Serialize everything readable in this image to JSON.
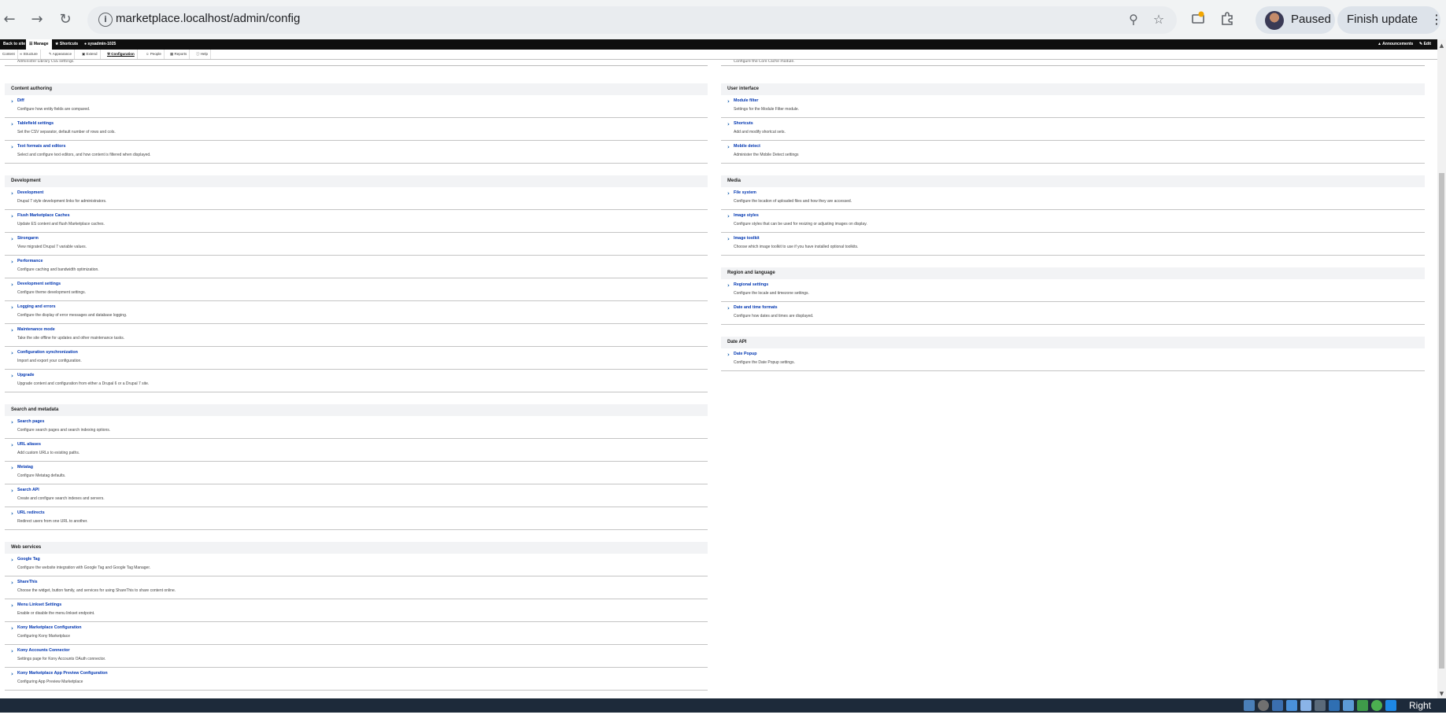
{
  "browser": {
    "url": "marketplace.localhost/admin/config",
    "profile_status": "Paused",
    "update_button": "Finish update",
    "icons": [
      "back-icon",
      "forward-icon",
      "reload-icon",
      "info-icon",
      "zoom-icon",
      "bookmark-star-icon",
      "extension-alert-icon",
      "puzzle-icon",
      "kebab-menu-icon"
    ]
  },
  "admin_toolbar": {
    "back": "Back to site",
    "manage": "Manage",
    "shortcuts": "Shortcuts",
    "user": "sysadmin-1025",
    "announcements": "Announcements",
    "edit": "Edit"
  },
  "tray": {
    "items": [
      "Content",
      "Structure",
      "Appearance",
      "Extend",
      "Configuration",
      "People",
      "Reports",
      "Help"
    ],
    "active": "Configuration"
  },
  "top_partial": {
    "left_desc": "Administer Library CSS settings.",
    "right_desc": "Configure the Core Cache module."
  },
  "left_panels": [
    {
      "heading": "Content authoring",
      "items": [
        {
          "title": "Diff",
          "desc": "Configure how entity fields are compared."
        },
        {
          "title": "Tablefield settings",
          "desc": "Set the CSV separator, default number of rows and cols."
        },
        {
          "title": "Text formats and editors",
          "desc": "Select and configure text editors, and how content is filtered when displayed."
        }
      ]
    },
    {
      "heading": "Development",
      "items": [
        {
          "title": "Development",
          "desc": "Drupal 7 style development links for administrators."
        },
        {
          "title": "Flush Marketplace Caches",
          "desc": "Update ES content and flush Marketplace caches."
        },
        {
          "title": "Strongarm",
          "desc": "View migrated Drupal 7 variable values."
        },
        {
          "title": "Performance",
          "desc": "Configure caching and bandwidth optimization."
        },
        {
          "title": "Development settings",
          "desc": "Configure theme development settings."
        },
        {
          "title": "Logging and errors",
          "desc": "Configure the display of error messages and database logging."
        },
        {
          "title": "Maintenance mode",
          "desc": "Take the site offline for updates and other maintenance tasks."
        },
        {
          "title": "Configuration synchronization",
          "desc": "Import and export your configuration."
        },
        {
          "title": "Upgrade",
          "desc": "Upgrade content and configuration from either a Drupal 6 or a Drupal 7 site."
        }
      ]
    },
    {
      "heading": "Search and metadata",
      "items": [
        {
          "title": "Search pages",
          "desc": "Configure search pages and search indexing options."
        },
        {
          "title": "URL aliases",
          "desc": "Add custom URLs to existing paths."
        },
        {
          "title": "Metatag",
          "desc": "Configure Metatag defaults."
        },
        {
          "title": "Search API",
          "desc": "Create and configure search indexes and servers."
        },
        {
          "title": "URL redirects",
          "desc": "Redirect users from one URL to another."
        }
      ]
    },
    {
      "heading": "Web services",
      "items": [
        {
          "title": "Google Tag",
          "desc": "Configure the website integration with Google Tag and Google Tag Manager."
        },
        {
          "title": "ShareThis",
          "desc": "Choose the widget, button family, and services for using ShareThis to share content online."
        },
        {
          "title": "Menu Linkset Settings",
          "desc": "Enable or disable the menu linkset endpoint."
        },
        {
          "title": "Kony Marketplace Configuration",
          "desc": "Configuring Kony Marketplace"
        },
        {
          "title": "Kony Accounts Connector",
          "desc": "Settings page for Kony Accounts OAuth connector."
        },
        {
          "title": "Kony Marketplace App Preview Configuration",
          "desc": "Configuring App Preview Marketplace"
        }
      ]
    }
  ],
  "right_panels": [
    {
      "heading": "User interface",
      "items": [
        {
          "title": "Module filter",
          "desc": "Settings for the Module Filter module."
        },
        {
          "title": "Shortcuts",
          "desc": "Add and modify shortcut sets."
        },
        {
          "title": "Mobile detect",
          "desc": "Administer the Mobile Detect settings"
        }
      ]
    },
    {
      "heading": "Media",
      "items": [
        {
          "title": "File system",
          "desc": "Configure the location of uploaded files and how they are accessed."
        },
        {
          "title": "Image styles",
          "desc": "Configure styles that can be used for resizing or adjusting images on display."
        },
        {
          "title": "Image toolkit",
          "desc": "Choose which image toolkit to use if you have installed optional toolkits."
        }
      ]
    },
    {
      "heading": "Region and language",
      "items": [
        {
          "title": "Regional settings",
          "desc": "Configure the locale and timezone settings."
        },
        {
          "title": "Date and time formats",
          "desc": "Configure how dates and times are displayed."
        }
      ]
    },
    {
      "heading": "Date API",
      "items": [
        {
          "title": "Date Popup",
          "desc": "Configure the Date Popup settings."
        }
      ]
    }
  ],
  "taskbar": {
    "label": "Right Ctrl"
  }
}
